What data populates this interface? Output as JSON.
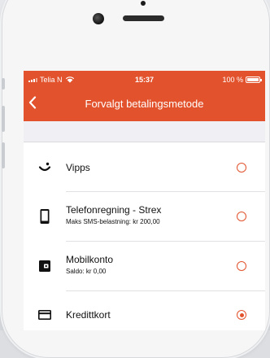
{
  "status_bar": {
    "carrier": "Telia N",
    "time": "15:37",
    "battery": "100 %"
  },
  "nav": {
    "title": "Forvalgt betalingsmetode",
    "back_icon": "chevron-left-icon"
  },
  "colors": {
    "accent": "#e2522c",
    "section_bg": "#efeff4"
  },
  "methods": [
    {
      "label": "Vipps",
      "icon": "vipps-icon",
      "selected": false
    },
    {
      "label": "Telefonregning - Strex",
      "sub": "Maks SMS-belastning: kr 200,00",
      "icon": "phone-icon",
      "selected": false
    },
    {
      "label": "Mobilkonto",
      "sub": "Saldo: kr 0,00",
      "icon": "wallet-icon",
      "selected": false
    },
    {
      "label": "Kredittkort",
      "icon": "credit-card-icon",
      "selected": true
    }
  ]
}
